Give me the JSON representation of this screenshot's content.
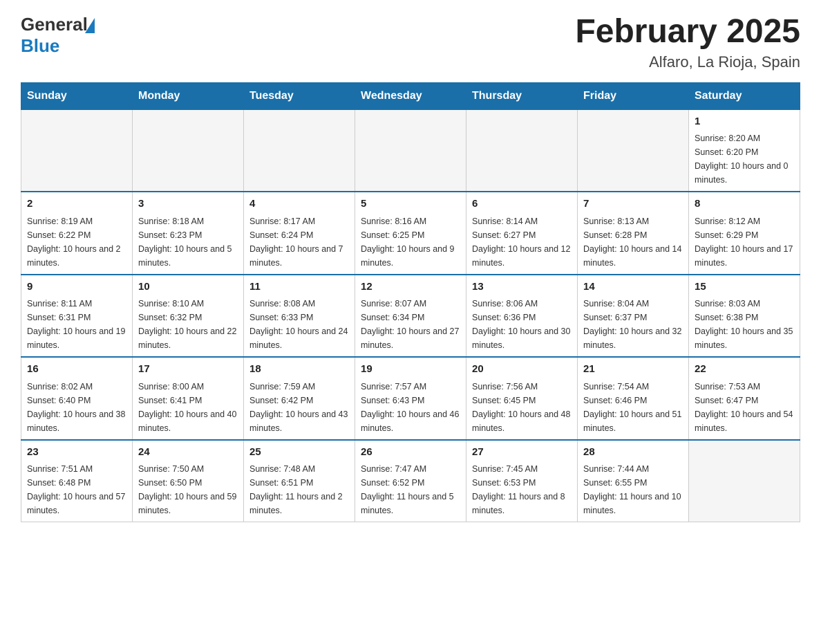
{
  "header": {
    "logo_general": "General",
    "logo_blue": "Blue",
    "month_title": "February 2025",
    "location": "Alfaro, La Rioja, Spain"
  },
  "days_of_week": [
    "Sunday",
    "Monday",
    "Tuesday",
    "Wednesday",
    "Thursday",
    "Friday",
    "Saturday"
  ],
  "weeks": [
    [
      {
        "day": "",
        "info": ""
      },
      {
        "day": "",
        "info": ""
      },
      {
        "day": "",
        "info": ""
      },
      {
        "day": "",
        "info": ""
      },
      {
        "day": "",
        "info": ""
      },
      {
        "day": "",
        "info": ""
      },
      {
        "day": "1",
        "info": "Sunrise: 8:20 AM\nSunset: 6:20 PM\nDaylight: 10 hours and 0 minutes."
      }
    ],
    [
      {
        "day": "2",
        "info": "Sunrise: 8:19 AM\nSunset: 6:22 PM\nDaylight: 10 hours and 2 minutes."
      },
      {
        "day": "3",
        "info": "Sunrise: 8:18 AM\nSunset: 6:23 PM\nDaylight: 10 hours and 5 minutes."
      },
      {
        "day": "4",
        "info": "Sunrise: 8:17 AM\nSunset: 6:24 PM\nDaylight: 10 hours and 7 minutes."
      },
      {
        "day": "5",
        "info": "Sunrise: 8:16 AM\nSunset: 6:25 PM\nDaylight: 10 hours and 9 minutes."
      },
      {
        "day": "6",
        "info": "Sunrise: 8:14 AM\nSunset: 6:27 PM\nDaylight: 10 hours and 12 minutes."
      },
      {
        "day": "7",
        "info": "Sunrise: 8:13 AM\nSunset: 6:28 PM\nDaylight: 10 hours and 14 minutes."
      },
      {
        "day": "8",
        "info": "Sunrise: 8:12 AM\nSunset: 6:29 PM\nDaylight: 10 hours and 17 minutes."
      }
    ],
    [
      {
        "day": "9",
        "info": "Sunrise: 8:11 AM\nSunset: 6:31 PM\nDaylight: 10 hours and 19 minutes."
      },
      {
        "day": "10",
        "info": "Sunrise: 8:10 AM\nSunset: 6:32 PM\nDaylight: 10 hours and 22 minutes."
      },
      {
        "day": "11",
        "info": "Sunrise: 8:08 AM\nSunset: 6:33 PM\nDaylight: 10 hours and 24 minutes."
      },
      {
        "day": "12",
        "info": "Sunrise: 8:07 AM\nSunset: 6:34 PM\nDaylight: 10 hours and 27 minutes."
      },
      {
        "day": "13",
        "info": "Sunrise: 8:06 AM\nSunset: 6:36 PM\nDaylight: 10 hours and 30 minutes."
      },
      {
        "day": "14",
        "info": "Sunrise: 8:04 AM\nSunset: 6:37 PM\nDaylight: 10 hours and 32 minutes."
      },
      {
        "day": "15",
        "info": "Sunrise: 8:03 AM\nSunset: 6:38 PM\nDaylight: 10 hours and 35 minutes."
      }
    ],
    [
      {
        "day": "16",
        "info": "Sunrise: 8:02 AM\nSunset: 6:40 PM\nDaylight: 10 hours and 38 minutes."
      },
      {
        "day": "17",
        "info": "Sunrise: 8:00 AM\nSunset: 6:41 PM\nDaylight: 10 hours and 40 minutes."
      },
      {
        "day": "18",
        "info": "Sunrise: 7:59 AM\nSunset: 6:42 PM\nDaylight: 10 hours and 43 minutes."
      },
      {
        "day": "19",
        "info": "Sunrise: 7:57 AM\nSunset: 6:43 PM\nDaylight: 10 hours and 46 minutes."
      },
      {
        "day": "20",
        "info": "Sunrise: 7:56 AM\nSunset: 6:45 PM\nDaylight: 10 hours and 48 minutes."
      },
      {
        "day": "21",
        "info": "Sunrise: 7:54 AM\nSunset: 6:46 PM\nDaylight: 10 hours and 51 minutes."
      },
      {
        "day": "22",
        "info": "Sunrise: 7:53 AM\nSunset: 6:47 PM\nDaylight: 10 hours and 54 minutes."
      }
    ],
    [
      {
        "day": "23",
        "info": "Sunrise: 7:51 AM\nSunset: 6:48 PM\nDaylight: 10 hours and 57 minutes."
      },
      {
        "day": "24",
        "info": "Sunrise: 7:50 AM\nSunset: 6:50 PM\nDaylight: 10 hours and 59 minutes."
      },
      {
        "day": "25",
        "info": "Sunrise: 7:48 AM\nSunset: 6:51 PM\nDaylight: 11 hours and 2 minutes."
      },
      {
        "day": "26",
        "info": "Sunrise: 7:47 AM\nSunset: 6:52 PM\nDaylight: 11 hours and 5 minutes."
      },
      {
        "day": "27",
        "info": "Sunrise: 7:45 AM\nSunset: 6:53 PM\nDaylight: 11 hours and 8 minutes."
      },
      {
        "day": "28",
        "info": "Sunrise: 7:44 AM\nSunset: 6:55 PM\nDaylight: 11 hours and 10 minutes."
      },
      {
        "day": "",
        "info": ""
      }
    ]
  ]
}
